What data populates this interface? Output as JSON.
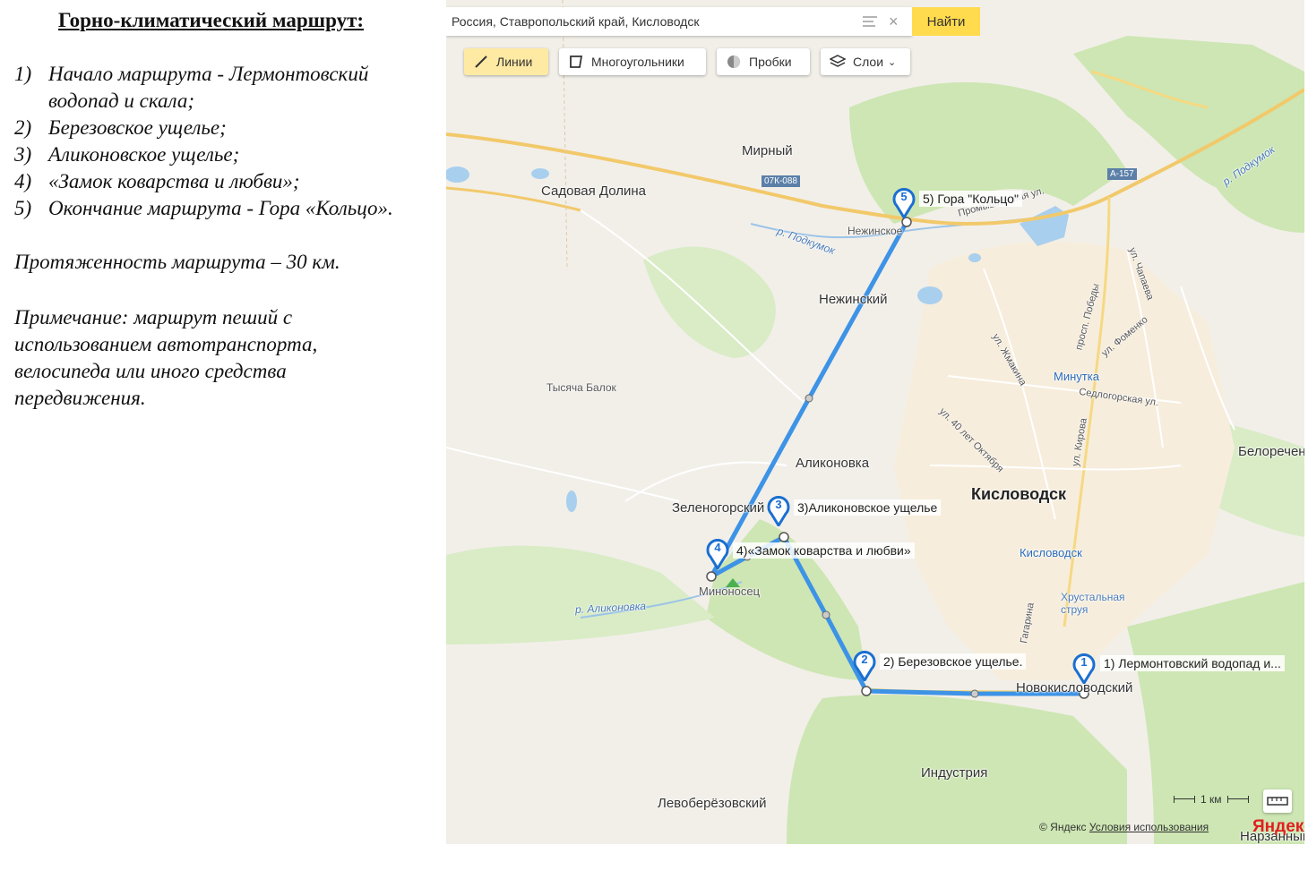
{
  "left_panel": {
    "title": "Горно-климатический  маршрут:",
    "items": [
      {
        "num": "1)",
        "text": "Начало маршрута - Лермонтовский водопад и скала;"
      },
      {
        "num": "2)",
        "text": "Березовское ущелье;"
      },
      {
        "num": "3)",
        "text": "Аликоновское ущелье;"
      },
      {
        "num": "4)",
        "text": "«Замок коварства и любви»;"
      },
      {
        "num": "5)",
        "text": "Окончание маршрута - Гора «Кольцо»."
      }
    ],
    "length": "Протяженность маршрута – 30 км.",
    "note": "Примечание: маршрут пеший с использованием автотранспорта, велосипеда или иного средства передвижения."
  },
  "search": {
    "value": "Россия, Ставропольский край, Кисловодск",
    "button": "Найти"
  },
  "toolbar": {
    "lines": "Линии",
    "polygons": "Многоугольники",
    "traffic": "Пробки",
    "layers": "Слои"
  },
  "route_points": [
    {
      "num": "1",
      "label": "1) Лермонтовский водопад и..."
    },
    {
      "num": "2",
      "label": "2) Березовское ущелье."
    },
    {
      "num": "3",
      "label": "3)Аликоновское ущелье"
    },
    {
      "num": "4",
      "label": "4)«Замок коварства и любви»"
    },
    {
      "num": "5",
      "label": "5) Гора \"Кольцо\""
    }
  ],
  "map_labels": {
    "city": "Кисловодск",
    "mirny": "Мирный",
    "sadovaya": "Садовая Долина",
    "nezhinskoe": "Нежинское",
    "nezhinsky": "Нежинский",
    "tysyacha": "Тысяча Балок",
    "alikonovka": "Аликоновка",
    "zelenogorsky": "Зеленогорский",
    "minonosec": "Миноносец",
    "novokislovodsky": "Новокисловодский",
    "industriya": "Индустрия",
    "leveberezovsky": "Левоберёзовский",
    "narzanny": "Нарзанный",
    "belorechensky": "Белореченский",
    "minutka": "Минутка",
    "station": "Кисловодск",
    "khrustalnaya": "Хрустальная струя",
    "river_podkumok1": "р. Подкумок",
    "river_podkumok2": "р. Подкумок",
    "river_alikonovka": "р. Аликоновка",
    "road_07k": "07К-088",
    "road_a157": "А-157",
    "promysh": "Промышленная ул.",
    "st_chapaeva": "ул. Чапаева",
    "st_pobedy": "просп. Победы",
    "st_fomenko": "ул. Фоменко",
    "st_zhmakina": "ул. Жмакина",
    "st_40let": "ул. 40 лет Октября",
    "st_kirova": "ул. Кирова",
    "st_sedlogorskaya": "Седлогорская ул.",
    "st_gagarina": "Гагарина"
  },
  "scale": "1 км",
  "copyright": {
    "prefix": "© Яндекс",
    "terms": "Условия использования",
    "logo": "Яндекс"
  }
}
